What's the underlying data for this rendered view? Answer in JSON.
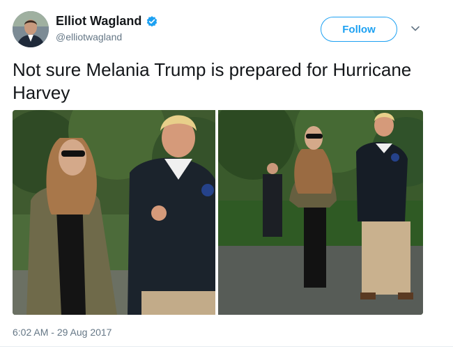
{
  "user": {
    "display_name": "Elliot Wagland",
    "handle": "@elliotwagland",
    "verified": true,
    "avatar_icon": "profile-photo"
  },
  "follow": {
    "label": "Follow",
    "chevron_icon": "chevron-down-icon"
  },
  "tweet": {
    "text": "Not sure Melania Trump is prepared for Hurricane Harvey"
  },
  "timestamp": {
    "time": "6:02 AM",
    "separator": " - ",
    "date": "29 Aug 2017"
  },
  "colors": {
    "accent": "#1da1f2",
    "text": "#14171a",
    "muted": "#657786"
  }
}
